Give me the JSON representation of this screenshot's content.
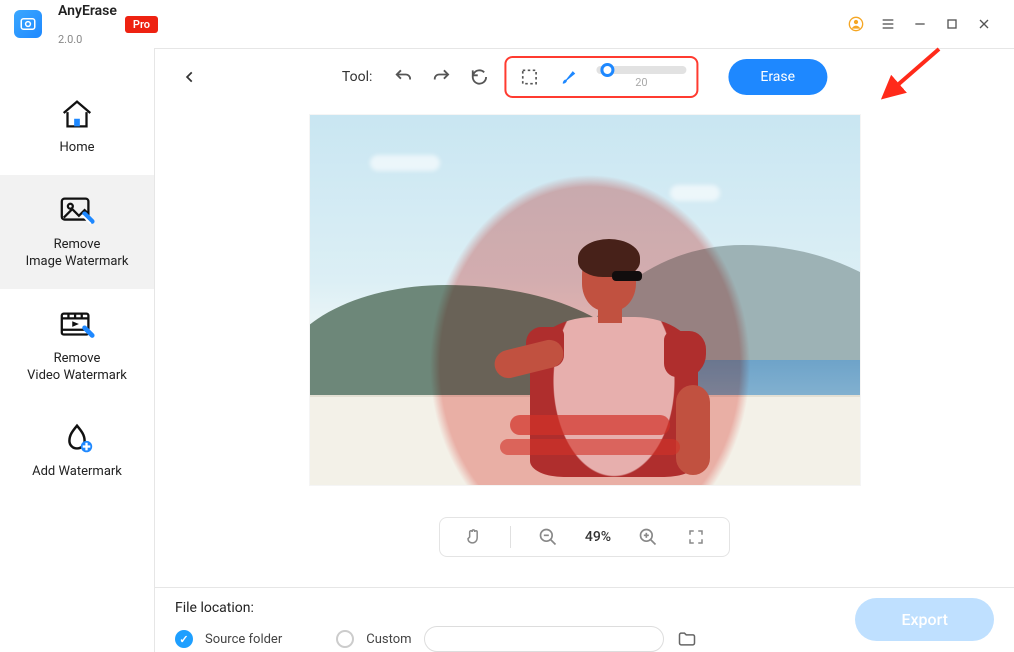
{
  "app": {
    "name": "AnyErase",
    "version": "2.0.0",
    "badge": "Pro"
  },
  "sidebar": {
    "items": [
      {
        "label": "Home"
      },
      {
        "label": "Remove\nImage Watermark"
      },
      {
        "label": "Remove\nVideo Watermark"
      },
      {
        "label": "Add Watermark"
      }
    ]
  },
  "toolbar": {
    "tool_label": "Tool:",
    "brush_size": "20",
    "erase_label": "Erase"
  },
  "zoom": {
    "value": "49%"
  },
  "bottom": {
    "location_label": "File location:",
    "source_label": "Source folder",
    "custom_label": "Custom",
    "export_label": "Export"
  }
}
